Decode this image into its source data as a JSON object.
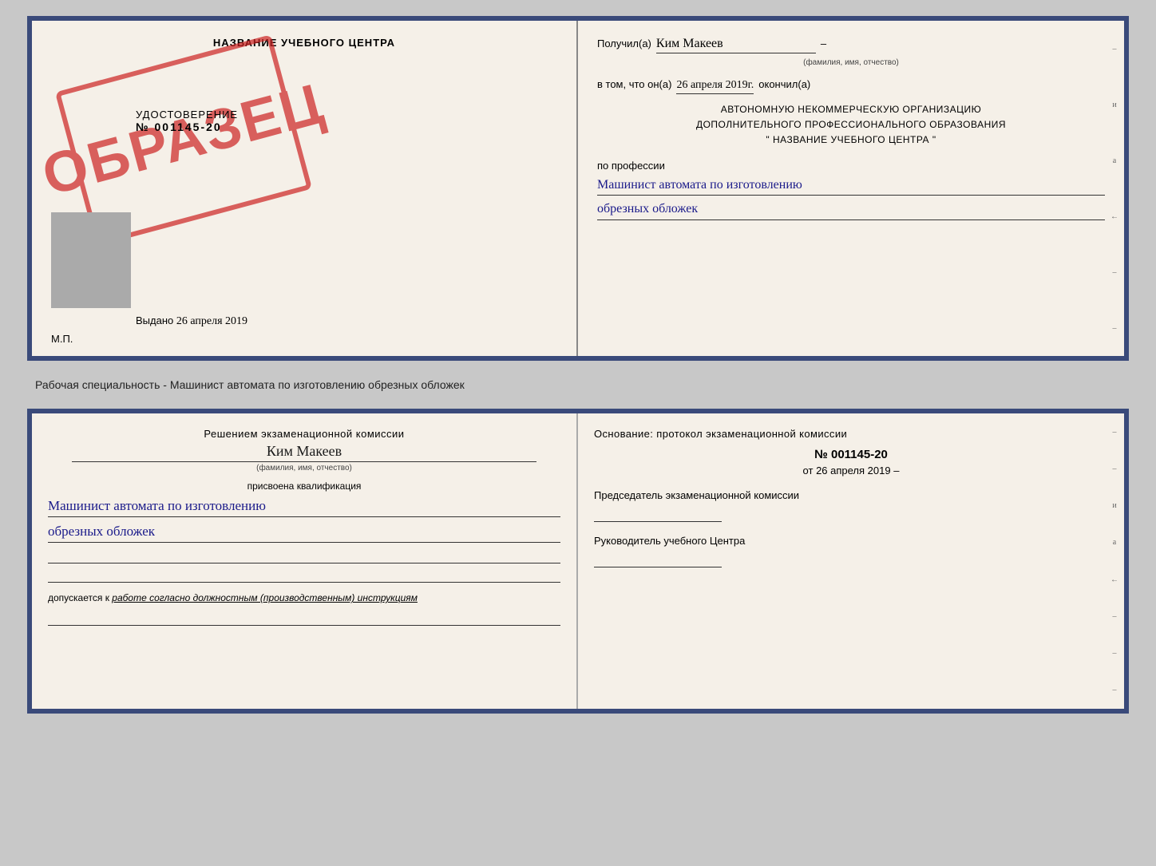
{
  "top_doc": {
    "left": {
      "school_name": "НАЗВАНИЕ УЧЕБНОГО ЦЕНТРА",
      "stamp_text": "ОБРАЗЕЦ",
      "udostoverenie_label": "УДОСТОВЕРЕНИЕ",
      "udostoverenie_num": "№ 001145-20",
      "vydano_label": "Выдано",
      "vydano_date": "26 апреля 2019",
      "mp_label": "М.П."
    },
    "right": {
      "poluchil_label": "Получил(а)",
      "poluchil_name": "Ким Макеев",
      "fio_hint": "(фамилия, имя, отчество)",
      "vtom_label": "в том, что он(а)",
      "vtom_date": "26 апреля 2019г.",
      "okonchil_label": "окончил(а)",
      "org_line1": "АВТОНОМНУЮ НЕКОММЕРЧЕСКУЮ ОРГАНИЗАЦИЮ",
      "org_line2": "ДОПОЛНИТЕЛЬНОГО ПРОФЕССИОНАЛЬНОГО ОБРАЗОВАНИЯ",
      "org_line3": "\"   НАЗВАНИЕ УЧЕБНОГО ЦЕНТРА   \"",
      "po_professii": "по профессии",
      "profession_line1": "Машинист автомата по изготовлению",
      "profession_line2": "обрезных обложек"
    }
  },
  "spec_description": "Рабочая специальность - Машинист автомата по изготовлению обрезных обложек",
  "bottom_doc": {
    "left": {
      "resheniem_label": "Решением экзаменационной комиссии",
      "fio_name": "Ким Макеев",
      "fio_hint": "(фамилия, имя, отчество)",
      "prisvoena_label": "присвоена квалификация",
      "profession_line1": "Машинист автомата по изготовлению",
      "profession_line2": "обрезных обложек",
      "dopuskaetsya_label": "допускается к",
      "dopuskaetsya_text": "работе согласно должностным (производственным) инструкциям"
    },
    "right": {
      "osnovanie_label": "Основание: протокол экзаменационной комиссии",
      "proto_num": "№ 001145-20",
      "proto_ot": "от",
      "proto_date": "26 апреля 2019",
      "predsedatel_label": "Председатель экзаменационной комиссии",
      "rukovoditel_label": "Руководитель учебного Центра"
    }
  },
  "right_marks": [
    "–",
    "и",
    "а",
    "←",
    "–",
    "–",
    "–"
  ]
}
